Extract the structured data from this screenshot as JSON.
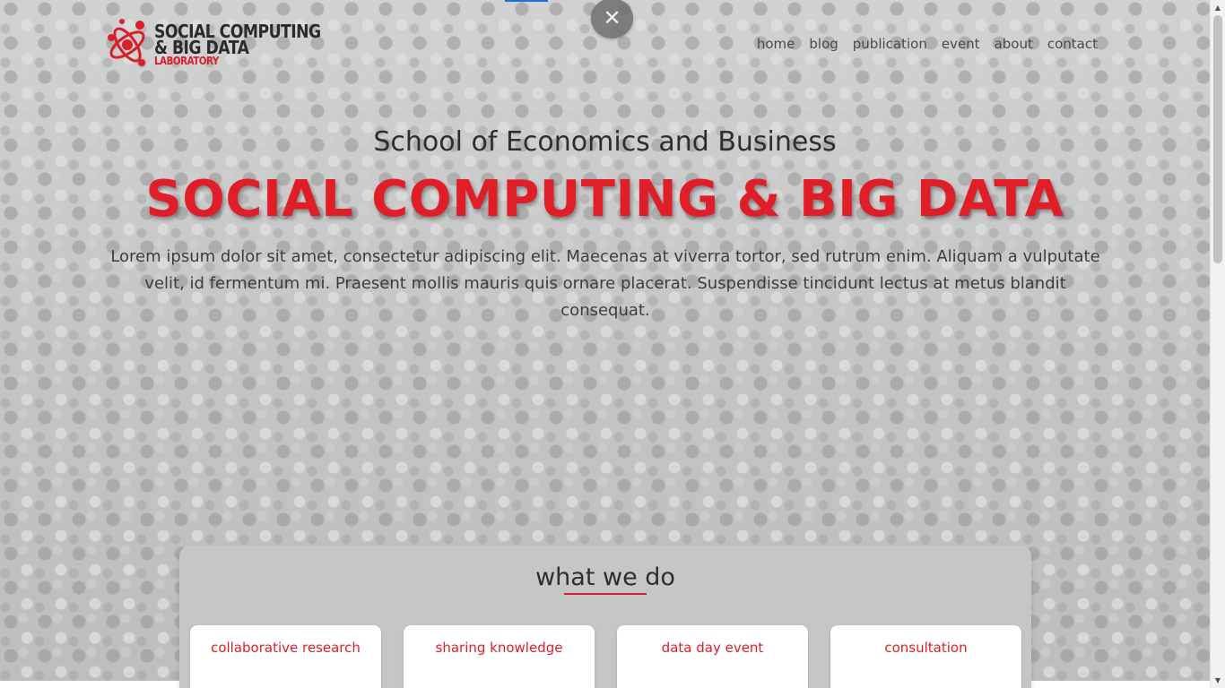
{
  "logo": {
    "line1": "SOCIAL COMPUTING",
    "line2": "& BIG DATA",
    "line3": "LABORATORY"
  },
  "close_button": {
    "icon": "close-icon",
    "glyph": "✕"
  },
  "nav": {
    "items": [
      {
        "label": "home"
      },
      {
        "label": "blog"
      },
      {
        "label": "publication"
      },
      {
        "label": "event"
      },
      {
        "label": "about"
      },
      {
        "label": "contact"
      }
    ]
  },
  "hero": {
    "subtitle": "School of Economics and Business",
    "title": "SOCIAL COMPUTING & BIG DATA",
    "description": "Lorem ipsum dolor sit amet, consectetur adipiscing elit. Maecenas at viverra tortor, sed rutrum enim. Aliquam a vulputate velit, id fermentum mi. Praesent mollis mauris quis ornare placerat. Suspendisse tincidunt lectus at metus blandit consequat."
  },
  "services": {
    "heading": "what we do",
    "cards": [
      {
        "label": "collaborative research"
      },
      {
        "label": "sharing knowledge"
      },
      {
        "label": "data day event"
      },
      {
        "label": "consultation"
      }
    ]
  },
  "scrollbar": {
    "up_glyph": "▲",
    "down_glyph": "▼"
  },
  "colors": {
    "accent_red": "#e01e28",
    "text_dark": "#2e2e2e",
    "panel_bg": "#c6c6c6"
  }
}
